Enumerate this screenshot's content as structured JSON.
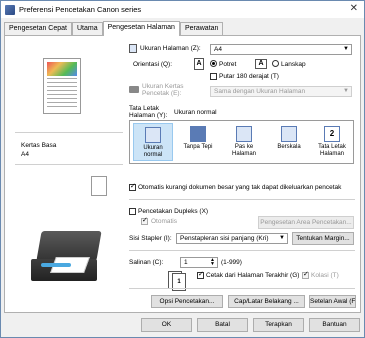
{
  "window": {
    "title": "Preferensi Pencetakan Canon series",
    "close_label": "✕"
  },
  "tabs": [
    {
      "label": "Pengesetan Cepat"
    },
    {
      "label": "Utama"
    },
    {
      "label": "Pengesetan Halaman"
    },
    {
      "label": "Perawatan"
    }
  ],
  "preview": {
    "media_label": "Kertas Basa",
    "size_label": "A4"
  },
  "page_size": {
    "label": "Ukuran Halaman (Z):",
    "value": "A4"
  },
  "orientation": {
    "label": "Orientasi (Q):",
    "portrait_label": "Potret",
    "landscape_label": "Lanskap",
    "rotate_label": "Putar 180 derajat (T)",
    "portrait_glyph": "A",
    "landscape_glyph": "A"
  },
  "printer_paper": {
    "label": "Ukuran Kertas Pencetak (E):",
    "value": "Sama dengan Ukuran Halaman"
  },
  "page_layout": {
    "label": "Tata Letak Halaman (Y):",
    "selected_value": "Ukuran normal",
    "items": [
      {
        "label": "Ukuran normal"
      },
      {
        "label": "Tanpa Tepi"
      },
      {
        "label": "Pas ke Halaman"
      },
      {
        "label": "Berskala"
      },
      {
        "label": "Tata Letak Halaman"
      }
    ],
    "layout_glyph": "2"
  },
  "auto_reduce": {
    "label": "Otomatis kurangi dokumen besar yang tak dapat dikeluarkan pencetak"
  },
  "duplex": {
    "label": "Pencetakan Dupleks (X)",
    "auto_label": "Otomatis",
    "area_button": "Pengesetan Area Pencetakan..."
  },
  "stapling": {
    "label": "Sisi Stapler (I):",
    "value": "Penstapleran sisi panjang (Kri)",
    "margin_button": "Tentukan Margin..."
  },
  "copies": {
    "label": "Salinan (C):",
    "value": "1",
    "range": "(1-999)",
    "last_page_label": "Cetak dari Halaman Terakhir (G)",
    "collate_label": "Kolasi (T)",
    "stack_glyph": "1"
  },
  "buttons": {
    "print_options": "Opsi Pencetakan...",
    "stamp": "Cap/Latar Belakang ...",
    "defaults": "Setelan Awal (F)"
  },
  "footer": {
    "ok": "OK",
    "cancel": "Batal",
    "apply": "Terapkan",
    "help": "Bantuan"
  }
}
